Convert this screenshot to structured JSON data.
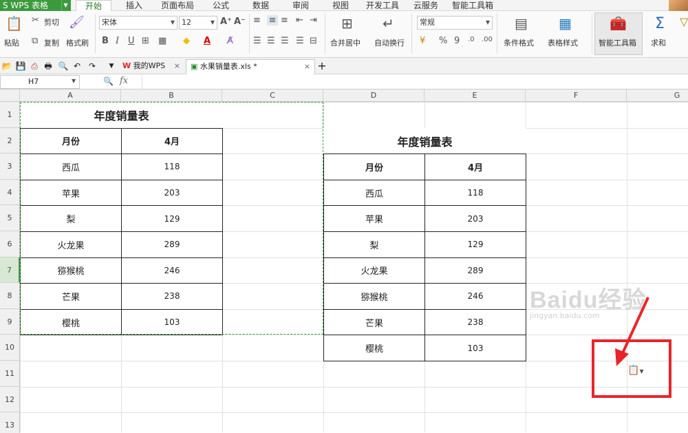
{
  "app": {
    "logo": "S WPS 表格"
  },
  "menu": {
    "tabs": [
      "开始",
      "插入",
      "页面布局",
      "公式",
      "数据",
      "审阅",
      "视图",
      "开发工具",
      "云服务",
      "智能工具箱"
    ],
    "active": "开始"
  },
  "ribbon": {
    "paste": "粘贴",
    "cut": "剪切",
    "copy": "复制",
    "format_painter": "格式刷",
    "font_name": "宋体",
    "font_size": "12",
    "merge_center": "合并居中",
    "wrap_text": "自动换行",
    "number_format": "常规",
    "percent": "%",
    "comma": "9",
    "cond_format": "条件格式",
    "table_style": "表格样式",
    "smart_toolbox": "智能工具箱",
    "sum": "求和"
  },
  "docs": {
    "tab1": "我的WPS",
    "tab2": "水果销量表.xls *"
  },
  "formula": {
    "cell_ref": "H7",
    "fx": "fx"
  },
  "columns": [
    "A",
    "B",
    "C",
    "D",
    "E",
    "F",
    "G"
  ],
  "rows": [
    "1",
    "2",
    "3",
    "4",
    "5",
    "6",
    "7",
    "8",
    "9",
    "10",
    "11",
    "12",
    "13"
  ],
  "table_left": {
    "title": "年度销量表",
    "headers": [
      "月份",
      "4月"
    ],
    "rows": [
      [
        "西瓜",
        "118"
      ],
      [
        "苹果",
        "203"
      ],
      [
        "梨",
        "129"
      ],
      [
        "火龙果",
        "289"
      ],
      [
        "猕猴桃",
        "246"
      ],
      [
        "芒果",
        "238"
      ],
      [
        "樱桃",
        "103"
      ]
    ]
  },
  "table_right": {
    "title": "年度销量表",
    "headers": [
      "月份",
      "4月"
    ],
    "rows": [
      [
        "西瓜",
        "118"
      ],
      [
        "苹果",
        "203"
      ],
      [
        "梨",
        "129"
      ],
      [
        "火龙果",
        "289"
      ],
      [
        "猕猴桃",
        "246"
      ],
      [
        "芒果",
        "238"
      ],
      [
        "樱桃",
        "103"
      ]
    ]
  },
  "watermark": {
    "line1": "Baidu经验",
    "line2": "jingyan.baidu.com"
  },
  "colors": {
    "accent": "#3c9a3c",
    "highlight": "#e8252b"
  }
}
